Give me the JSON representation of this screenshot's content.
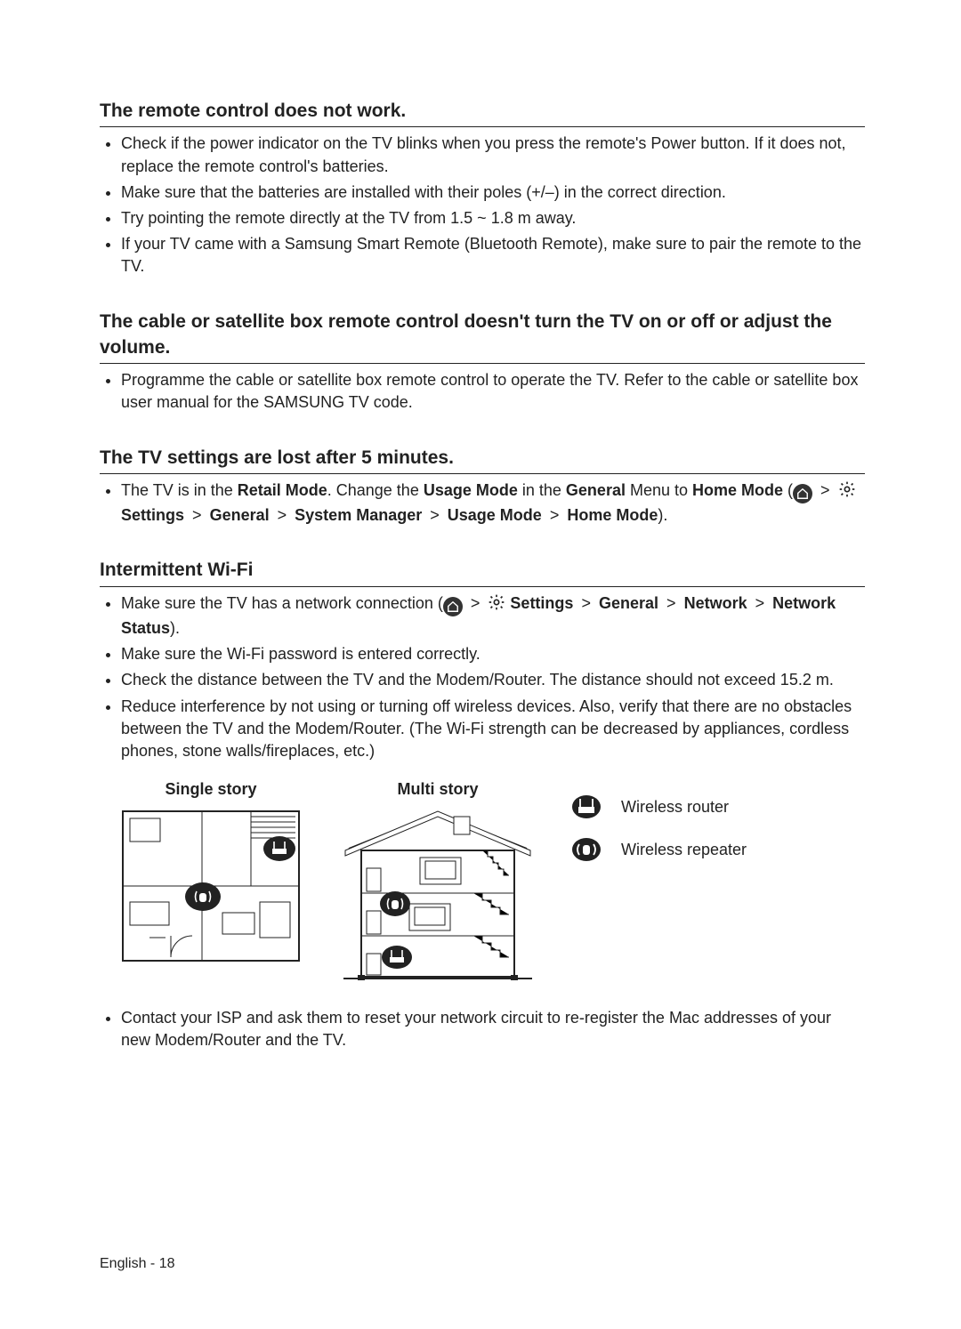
{
  "sections": [
    {
      "heading": "The remote control does not work.",
      "bullets": [
        {
          "text": "Check if the power indicator on the TV blinks when you press the remote's Power button. If it does not, replace the remote control's batteries."
        },
        {
          "text": "Make sure that the batteries are installed with their poles (+/–) in the correct direction."
        },
        {
          "text": "Try pointing the remote directly at the TV from 1.5 ~ 1.8 m away."
        },
        {
          "text": "If your TV came with a Samsung Smart Remote (Bluetooth Remote), make sure to pair the remote to the TV."
        }
      ]
    },
    {
      "heading": "The cable or satellite box remote control doesn't turn the TV on or off or adjust the volume.",
      "bullets": [
        {
          "text": "Programme the cable or satellite box remote control to operate the TV. Refer to the cable or satellite box user manual for the SAMSUNG TV code."
        }
      ]
    },
    {
      "heading": "The TV settings are lost after 5 minutes.",
      "retail": {
        "pre": "The TV is in the ",
        "retail_mode": "Retail Mode",
        "mid1": ". Change the ",
        "usage_mode": "Usage Mode",
        "mid2": " in the ",
        "general": "General",
        "mid3": " Menu to ",
        "home_mode": "Home Mode",
        "open": " (",
        "chev": ">",
        "settings": "Settings",
        "system_manager": "System Manager",
        "close": ")."
      }
    },
    {
      "heading": "Intermittent Wi-Fi",
      "wifi_line": {
        "pre": "Make sure the TV has a network connection (",
        "chev": ">",
        "settings": "Settings",
        "general": "General",
        "network": "Network",
        "network_status": "Network Status",
        "close": ")."
      },
      "bullets_after": [
        "Make sure the Wi-Fi password is entered correctly.",
        "Check the distance between the TV and the Modem/Router. The distance should not exceed 15.2 m.",
        "Reduce interference by not using or turning off wireless devices. Also, verify that there are no obstacles between the TV and the Modem/Router. (The Wi-Fi strength can be decreased by appliances, cordless phones, stone walls/fireplaces, etc.)"
      ],
      "diagrams": {
        "single_story": "Single story",
        "multi_story": "Multi story",
        "legend_router": "Wireless router",
        "legend_repeater": "Wireless repeater"
      },
      "final_bullet": "Contact your ISP and ask them to reset your network circuit to re-register the Mac addresses of your new Modem/Router and the TV."
    }
  ],
  "footer": "English - 18"
}
